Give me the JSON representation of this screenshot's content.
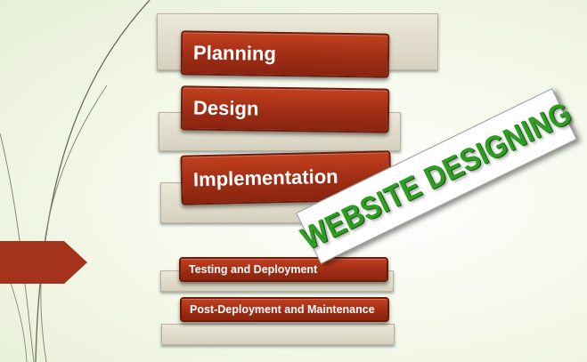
{
  "steps": [
    {
      "label": "Planning"
    },
    {
      "label": "Design"
    },
    {
      "label": "Implementation"
    },
    {
      "label": "Testing and Deployment"
    },
    {
      "label": "Post-Deployment and Maintenance"
    }
  ],
  "banner": {
    "text": "WEBSITE DESIGNING"
  },
  "colors": {
    "step_fill": "#a5321a",
    "banner_text": "#2e9e22",
    "background": "#f5f9ec"
  }
}
